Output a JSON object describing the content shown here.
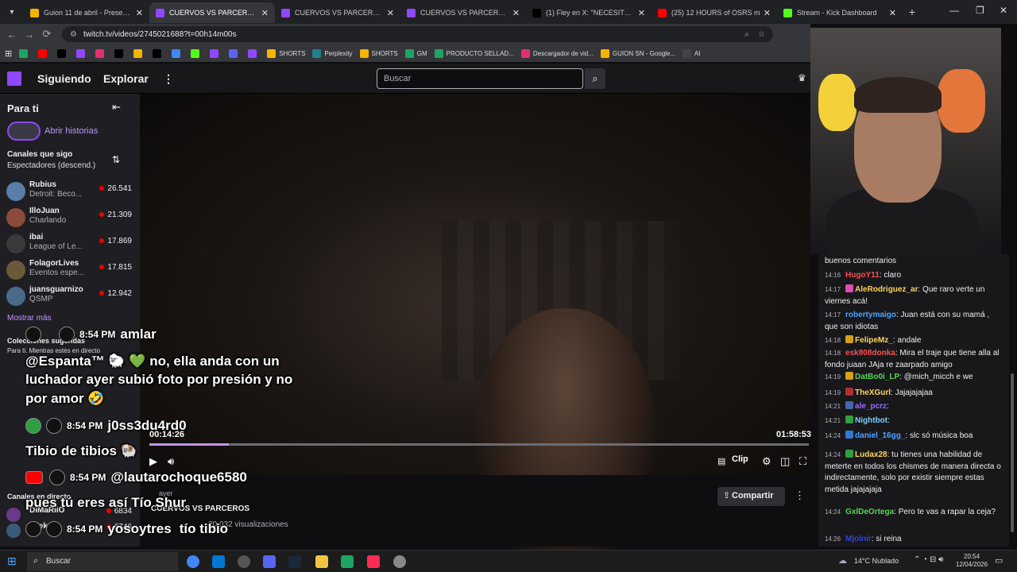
{
  "browser": {
    "tabs": [
      {
        "title": "Guion 11 de abril - Presentación",
        "color": "#f4b400"
      },
      {
        "title": "CUERVOS VS PARCEROS - Twitch",
        "color": "#9147ff",
        "active": true
      },
      {
        "title": "CUERVOS VS PARCEROS - Twitch",
        "color": "#9147ff"
      },
      {
        "title": "CUERVOS VS PARCEROS -",
        "color": "#9147ff"
      },
      {
        "title": "(1) Fley en X: \"NECESITO AY",
        "color": "#000000"
      },
      {
        "title": "(25) 12 HOURS of OSRS m",
        "color": "#ff0000"
      },
      {
        "title": "Stream - Kick Dashboard",
        "color": "#53fc18"
      }
    ],
    "url": "twitch.tv/videos/2745021688?t=00h14m00s",
    "bookmarks": [
      {
        "label": "",
        "color": "#1fa463"
      },
      {
        "label": "",
        "color": "#ff0000"
      },
      {
        "label": "",
        "color": "#000000"
      },
      {
        "label": "",
        "color": "#9147ff"
      },
      {
        "label": "",
        "color": "#e1306c"
      },
      {
        "label": "",
        "color": "#000000"
      },
      {
        "label": "",
        "color": "#f4b400"
      },
      {
        "label": "",
        "color": "#000000"
      },
      {
        "label": "",
        "color": "#4285f4"
      },
      {
        "label": "",
        "color": "#53fc18"
      },
      {
        "label": "",
        "color": "#9147ff"
      },
      {
        "label": "",
        "color": "#5865f2"
      },
      {
        "label": "",
        "color": "#9147ff"
      },
      {
        "label": "SHORTS",
        "color": "#f4b400"
      },
      {
        "label": "Perplexity",
        "color": "#20808d"
      },
      {
        "label": "SHORTS",
        "color": "#f4b400"
      },
      {
        "label": "GM",
        "color": "#1fa463"
      },
      {
        "label": "PRODUCTO SELLAD...",
        "color": "#1fa463"
      },
      {
        "label": "Descargador de vid...",
        "color": "#e1306c"
      },
      {
        "label": "GUION SN - Google...",
        "color": "#f4b400"
      },
      {
        "label": "AI",
        "color": "#444444"
      }
    ]
  },
  "twitch": {
    "nav": {
      "following": "Siguiendo",
      "explore": "Explorar",
      "more": "⋮"
    },
    "search_placeholder": "Buscar",
    "sidebar": {
      "for_you": "Para ti",
      "collapse": "⇤",
      "stories": "Abrir historias",
      "followed_header": "Canales que sigo",
      "sort_label": "Espectadores (descend.)",
      "channels": [
        {
          "name": "Rubius",
          "game": "Detroit: Beco...",
          "viewers": "26.541",
          "color": "#5a7ea8"
        },
        {
          "name": "IlloJuan",
          "game": "Charlando",
          "viewers": "21.309",
          "color": "#8b4a3a"
        },
        {
          "name": "ibai",
          "game": "League of Le...",
          "viewers": "17.869",
          "color": "#3a3a3a"
        },
        {
          "name": "FolagorLives",
          "game": "Eventos espe...",
          "viewers": "17.815",
          "color": "#6a5a3a"
        },
        {
          "name": "juansguarnizo",
          "game": "QSMP",
          "viewers": "12.942",
          "color": "#4a6a8a"
        }
      ],
      "show_more": "Mostrar más",
      "suggested_header": "Colecciones sugeridas",
      "suggested_sub": "Para ti. Mientras estés en directo",
      "live_header": "Canales en directo",
      "live_channels": [
        {
          "name": "DiMaRiiO",
          "viewers": "6834",
          "color": "#6a3a8a"
        },
        {
          "name": "knekro",
          "viewers": "6746",
          "color": "#3a5a7a"
        }
      ]
    },
    "video": {
      "current_time": "00:14:26",
      "duration": "01:58:53",
      "progress": 0.12,
      "clip_label": "Clip",
      "title": "CUERVOS VS PARCEROS",
      "views": "· 20.032 visualizaciones",
      "date": "ayer",
      "share_label": "Compartir"
    },
    "chat": [
      {
        "time": "",
        "user": "",
        "color": "#efeff1",
        "text": "buenos comentarios",
        "badge": ""
      },
      {
        "time": "14:16",
        "user": "HugoY11",
        "color": "#ff4f4f",
        "text": ": claro",
        "badge": ""
      },
      {
        "time": "14:17",
        "user": "AleRodriguez_ar",
        "color": "#ffd35a",
        "text": ": Que raro verte un viernes acá!",
        "badge": "#e04cb5"
      },
      {
        "time": "14:17",
        "user": "robertymaigo",
        "color": "#4ea3ff",
        "text": ": Juan está con su mamá , que son idiotas",
        "badge": ""
      },
      {
        "time": "14:18",
        "user": "FelipeMz_",
        "color": "#ffd35a",
        "text": ": andale",
        "badge": "#d4a017"
      },
      {
        "time": "14:18",
        "user": "esk808donka",
        "color": "#ff4f4f",
        "text": ": Mira el traje que tiene alla al fondo juaan JAja re zaarpado amigo",
        "badge": ""
      },
      {
        "time": "14:19",
        "user": "DatBo0i_LP",
        "color": "#5ad35a",
        "text": ": @mich_micch e we",
        "badge": "#d4a017"
      },
      {
        "time": "14:19",
        "user": "TheXGurl",
        "color": "#ffd35a",
        "text": ": Jajajajajaa",
        "badge": "#b03030"
      },
      {
        "time": "14:21",
        "user": "ale_pcrz",
        "color": "#9a6bff",
        "text": ":",
        "badge": "#4466aa"
      },
      {
        "time": "14:21",
        "user": "Nightbot",
        "color": "#7ad0ff",
        "text": ":",
        "badge": "#2ea043"
      },
      {
        "time": "14:24",
        "user": "daniel_16gg_",
        "color": "#4ea3ff",
        "text": ": slc só música boa",
        "badge": "#2f7ad3"
      },
      {
        "time": "14:24",
        "user": "Ludax28",
        "color": "#ffd35a",
        "text": ": tu tienes una habilidad de meterte en todos los chismes de manera directa o indirectamente, solo por existir siempre estas metida jajajajaja",
        "badge": "#2ea043"
      },
      {
        "time": "14:24",
        "user": "GxlDeOrtega",
        "color": "#5ad35a",
        "text": ": Pero te vas a rapar la ceja?",
        "badge": ""
      },
      {
        "time": "14:26",
        "user": "Mjolnir",
        "color": "#3344cc",
        "text": ": si reina",
        "badge": ""
      }
    ]
  },
  "overlay": {
    "comments": [
      {
        "time": "8:54 PM",
        "user": "amlar",
        "text": "@Espanta™ 🐑 💚 no, ella anda con un"
      },
      {
        "time": "",
        "user": "",
        "text": "luchador ayer subió foto por presión y no"
      },
      {
        "time": "",
        "user": "",
        "text": "por amor 🤣"
      },
      {
        "time": "8:54 PM",
        "user": "j0ss3du4rd0",
        "text": "Tibio de tibios 🐏"
      },
      {
        "time": "8:54 PM",
        "user": "@lautarochoque6580",
        "text": "pues tú eres así Tío Shur"
      },
      {
        "time": "8:54 PM",
        "user": "yosoytres",
        "text": "tío tibio"
      }
    ]
  },
  "taskbar": {
    "search": "Buscar",
    "weather": "14°C  Nublado",
    "time": "20:54",
    "date": "12/04/2026"
  }
}
